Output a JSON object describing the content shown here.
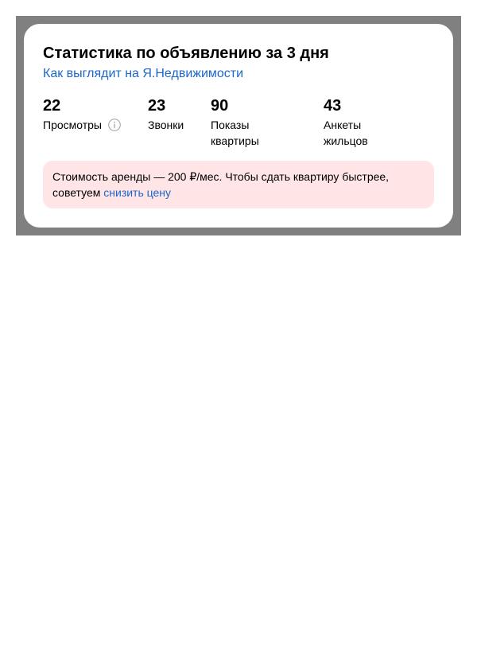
{
  "card": {
    "title": "Статистика по объявлению за 3 дня",
    "view_link": "Как выглядит на Я.Недвижимости"
  },
  "stats": [
    {
      "value": "22",
      "label": "Просмотры",
      "icon": "info-icon"
    },
    {
      "value": "23",
      "label": "Звонки"
    },
    {
      "value": "90",
      "label": "Показы квартиры"
    },
    {
      "value": "43",
      "label": "Анкеты жильцов"
    }
  ],
  "notice": {
    "text": "Стоимость аренды — 200 ₽/мес. Чтобы сдать квартиру быстрее, советуем",
    "link": "снизить цену"
  },
  "colors": {
    "backdrop": "#808080",
    "link": "#1a66cc",
    "notice_bg": "#ffe5e6"
  }
}
